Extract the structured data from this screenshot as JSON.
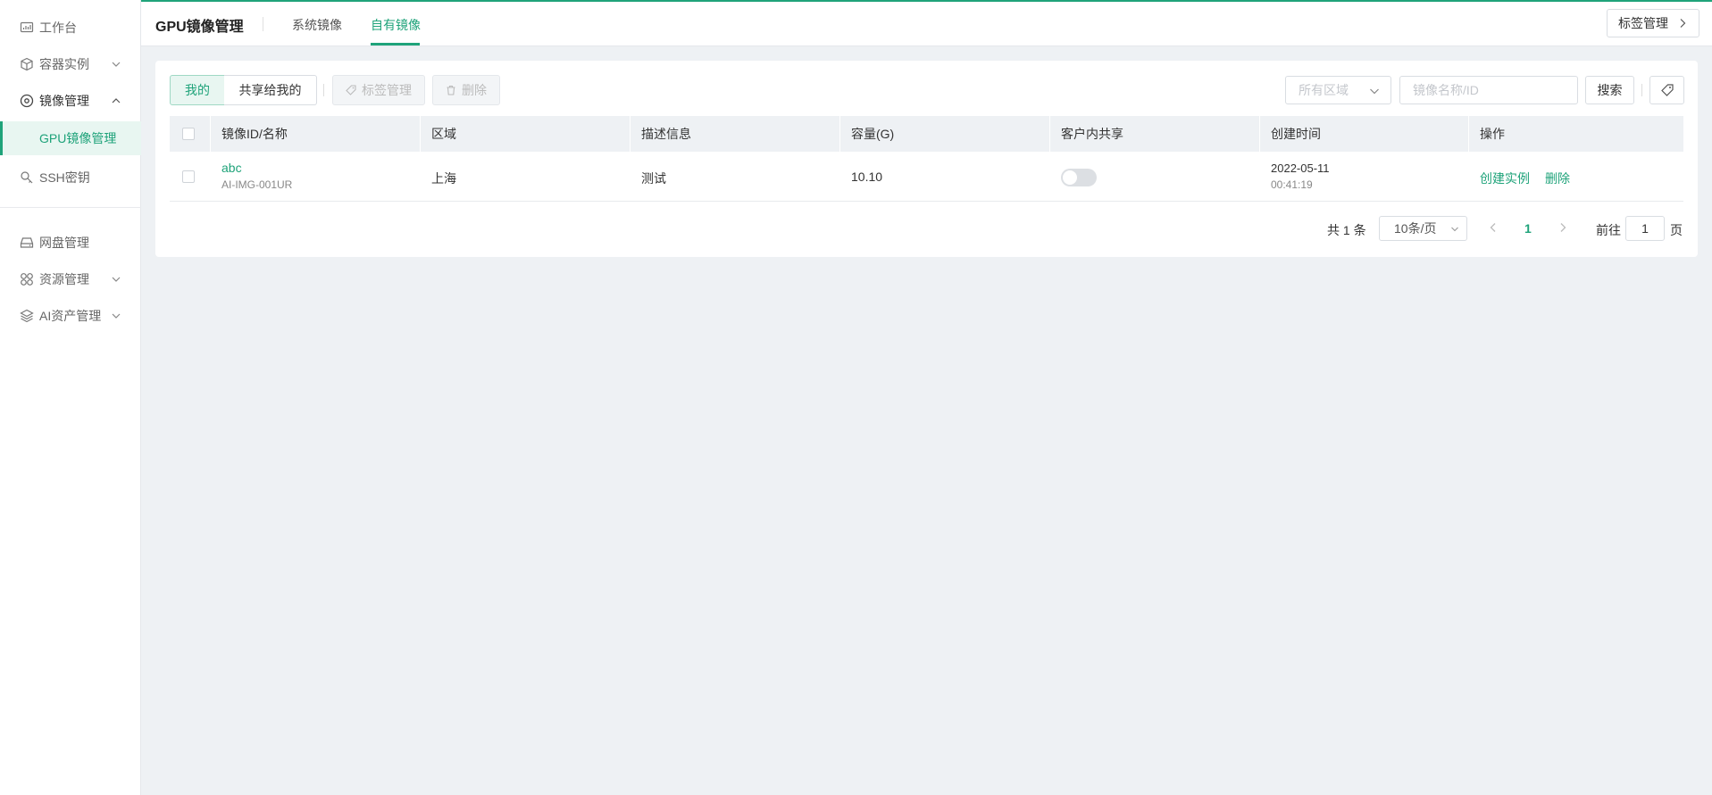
{
  "colors": {
    "accent": "#1fa37a",
    "bg": "#eef1f4"
  },
  "sidebar": {
    "items": [
      {
        "label": "工作台",
        "icon": "dashboard-icon"
      },
      {
        "label": "容器实例",
        "icon": "cube-icon"
      },
      {
        "label": "镜像管理",
        "icon": "disc-icon"
      },
      {
        "label": "GPU镜像管理"
      },
      {
        "label": "SSH密钥",
        "icon": "key-icon"
      },
      {
        "label": "网盘管理",
        "icon": "drive-icon"
      },
      {
        "label": "资源管理",
        "icon": "grid-icon"
      },
      {
        "label": "AI资产管理",
        "icon": "layers-icon"
      }
    ]
  },
  "header": {
    "title": "GPU镜像管理",
    "tabs": [
      {
        "label": "系统镜像"
      },
      {
        "label": "自有镜像"
      }
    ],
    "tag_manage": "标签管理"
  },
  "toolbar": {
    "mine": "我的",
    "shared": "共享给我的",
    "tag_manage": "标签管理",
    "delete": "删除",
    "region_placeholder": "所有区域",
    "search_placeholder": "镜像名称/ID",
    "search": "搜索"
  },
  "table": {
    "columns": [
      "镜像ID/名称",
      "区域",
      "描述信息",
      "容量(G)",
      "客户内共享",
      "创建时间",
      "操作"
    ],
    "rows": [
      {
        "name": "abc",
        "id": "AI-IMG-001UR",
        "region": "上海",
        "description": "测试",
        "capacity": "10.10",
        "shared": false,
        "date": "2022-05-11",
        "time": "00:41:19",
        "action_create": "创建实例",
        "action_delete": "删除"
      }
    ]
  },
  "pagination": {
    "total": "共 1 条",
    "page_size": "10条/页",
    "current": "1",
    "goto_label": "前往",
    "goto_value": "1",
    "page_suffix": "页"
  }
}
